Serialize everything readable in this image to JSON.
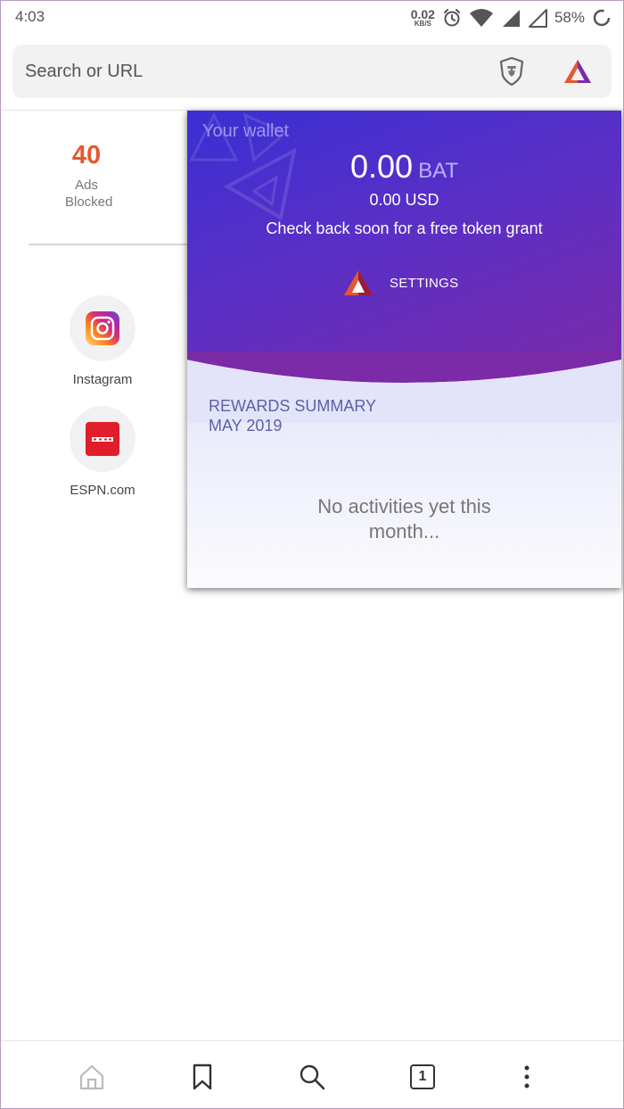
{
  "status_bar": {
    "time": "4:03",
    "net_speed": "0.02",
    "net_unit": "KB/S",
    "battery": "58%",
    "icons": [
      "alarm-icon",
      "wifi-icon",
      "signal-icon",
      "signal-empty-icon",
      "loading-ring-icon"
    ]
  },
  "address_bar": {
    "placeholder": "Search or URL",
    "icons": [
      "brave-shield-icon",
      "bat-rewards-icon"
    ]
  },
  "new_tab": {
    "ads_blocked_count": "40",
    "ads_blocked_label": "Ads Blocked",
    "top_sites": [
      {
        "label": "Instagram",
        "icon": "instagram-icon"
      },
      {
        "label": "ESPN.com",
        "icon": "espn-icon"
      }
    ]
  },
  "rewards_panel": {
    "wallet_title": "Your wallet",
    "bat_balance": "0.00",
    "bat_currency": "BAT",
    "usd_balance": "0.00 USD",
    "grant_message": "Check back soon for a free token grant",
    "settings_label": "SETTINGS",
    "summary_title": "REWARDS SUMMARY",
    "summary_month": "MAY 2019",
    "empty_message": "No activities yet this month...",
    "colors": {
      "header_start": "#3a2fd3",
      "header_end": "#7b2aa8",
      "accent": "#e4582e"
    }
  },
  "bottom_nav": {
    "tab_count": "1",
    "icons": [
      "home-icon",
      "bookmark-icon",
      "search-icon",
      "tab-switcher-icon",
      "more-menu-icon"
    ]
  }
}
